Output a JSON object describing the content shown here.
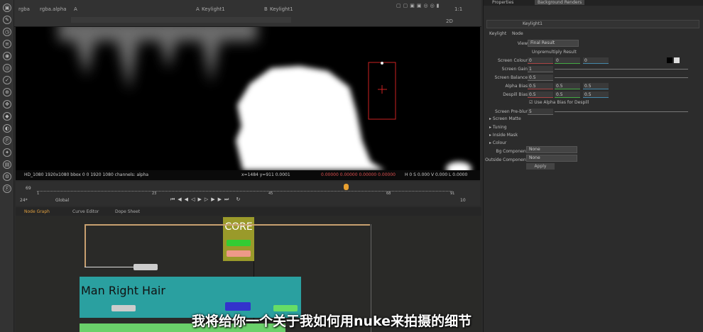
{
  "viewer": {
    "header": {
      "channels": "rgba",
      "layer": "rgba.alpha",
      "input_a": "A",
      "input_a_node": "Keylight1",
      "input_b": "B",
      "input_b_node": "Keylight1",
      "zoom": "1:1",
      "mode": "2D"
    },
    "info_text": "HD_1080 1920x1080  bbox 0 0 1920 1080 channels: alpha",
    "coords": "x=1484 y=911 0.0001",
    "pixel_values": "0.00000 0.00000 0.00000 0.00000",
    "hsv": "H 0 S 0.000 V 0.000  L 0.0000"
  },
  "timeline": {
    "start_frame": "1",
    "end_frame": "91",
    "ticks": [
      "1",
      "23",
      "45",
      "68",
      "91"
    ],
    "current_frame": "69",
    "fps": "24*",
    "playback_range": "Global",
    "frame_increment": "10",
    "colors": {
      "playhead": "#e8a030"
    }
  },
  "node_graph": {
    "tabs": [
      {
        "label": "Node Graph"
      },
      {
        "label": "Curve Editor"
      },
      {
        "label": "Dope Sheet"
      }
    ],
    "backdrops": [
      {
        "label": "CORE",
        "color": "#9a9a2a"
      },
      {
        "label": "Man Right Hair",
        "color": "#2aa0a0"
      },
      {
        "label": "",
        "color": "#6ad06a"
      }
    ]
  },
  "properties": {
    "tabs": [
      "Properties",
      "Background Renders"
    ],
    "node_name": "Keylight1",
    "panel_tabs": [
      "Keylight",
      "Node"
    ],
    "view_label": "View",
    "view_value": "Final Result",
    "unpremultiply_label": "Unpremultiply Result",
    "rows": [
      {
        "label": "Screen Colour",
        "values": [
          "0",
          "0",
          "0"
        ]
      },
      {
        "label": "Screen Gain",
        "values": [
          "1"
        ]
      },
      {
        "label": "Screen Balance",
        "values": [
          "0.5"
        ]
      },
      {
        "label": "Alpha Bias",
        "values": [
          "0.5",
          "0.5",
          "0.5"
        ]
      },
      {
        "label": "Despill Bias",
        "values": [
          "0.5",
          "0.5",
          "0.5"
        ]
      }
    ],
    "checkbox_label": "Use Alpha Bias for Despill",
    "screen_prefilter_label": "Screen Pre-blur",
    "screen_prefilter_value": "5",
    "groups": [
      "Screen Matte",
      "Tuning",
      "Inside Mask",
      "Colour"
    ],
    "source_label": "Bg Component",
    "source_value": "None",
    "outside_label": "Outside Component",
    "outside_value": "None",
    "apply_label": "Apply"
  },
  "subtitle": "我将给你一个关于我如何用nuke来拍摄的细节"
}
